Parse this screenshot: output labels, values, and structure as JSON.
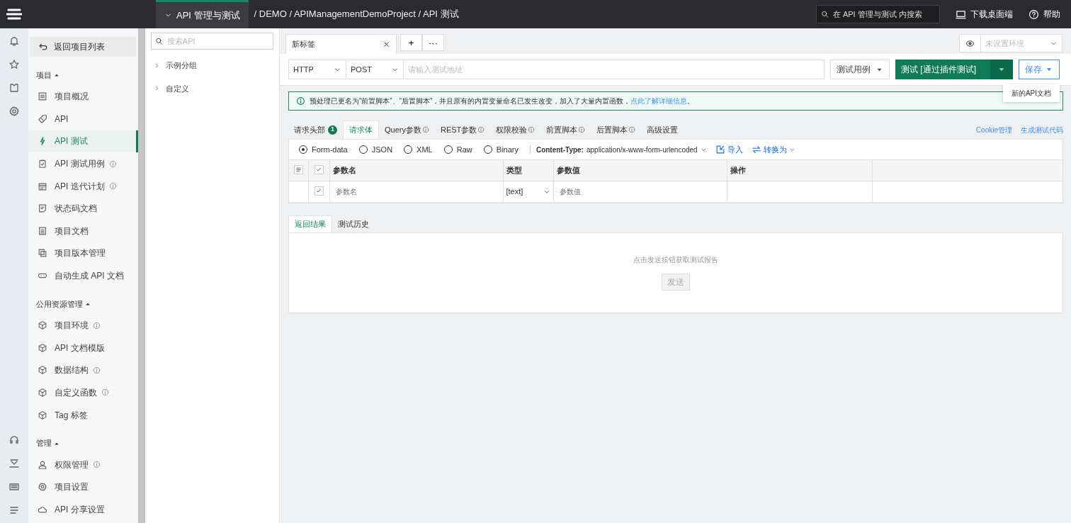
{
  "topbar": {
    "module": {
      "label": "API 管理与测试",
      "selected": true
    },
    "breadcrumb": "/ DEMO / APIManagementDemoProject / API 测试",
    "search_placeholder": "在 API 管理与测试 内搜索",
    "download": "下载桌面端",
    "help": "帮助"
  },
  "sidebar": {
    "back": "返回项目列表",
    "sections": [
      {
        "title": "项目",
        "expanded": true,
        "items": [
          {
            "label": "项目概况",
            "info": false,
            "selected": false
          },
          {
            "label": "API",
            "info": false,
            "selected": false
          },
          {
            "label": "API 测试",
            "info": false,
            "selected": true
          },
          {
            "label": "API 测试用例",
            "info": true,
            "selected": false
          },
          {
            "label": "API 迭代计划",
            "info": true,
            "selected": false
          },
          {
            "label": "状态码文档",
            "info": false,
            "selected": false
          },
          {
            "label": "项目文档",
            "info": false,
            "selected": false
          },
          {
            "label": "项目版本管理",
            "info": false,
            "selected": false
          },
          {
            "label": "自动生成 API 文档",
            "info": false,
            "selected": false
          }
        ]
      },
      {
        "title": "公用资源管理",
        "expanded": true,
        "items": [
          {
            "label": "项目环境",
            "info": true,
            "selected": false
          },
          {
            "label": "API 文档模版",
            "info": false,
            "selected": false
          },
          {
            "label": "数据结构",
            "info": true,
            "selected": false
          },
          {
            "label": "自定义函数",
            "info": true,
            "selected": false
          },
          {
            "label": "Tag 标签",
            "info": false,
            "selected": false
          }
        ]
      },
      {
        "title": "管理",
        "expanded": true,
        "items": [
          {
            "label": "权限管理",
            "info": true,
            "selected": false
          },
          {
            "label": "项目设置",
            "info": false,
            "selected": false
          },
          {
            "label": "API 分享设置",
            "info": false,
            "selected": false
          }
        ]
      }
    ]
  },
  "api_tree": {
    "search_placeholder": "搜索API",
    "groups": [
      {
        "label": "示例分组",
        "expanded": false
      },
      {
        "label": "自定义",
        "expanded": false
      }
    ]
  },
  "tabs": [
    {
      "label": "新标签",
      "selected": true
    }
  ],
  "tab_actions": [
    "+",
    "···"
  ],
  "environment": {
    "placeholder": "未设置环境"
  },
  "request": {
    "protocol": "HTTP",
    "method": "POST",
    "url_placeholder": "请输入测试地址",
    "test_case": "测试用例",
    "test_button": "测试 [通过插件测试]",
    "save_button": "保存",
    "save_menu": [
      "新的API文档"
    ]
  },
  "notice": {
    "text": "预处理已更名为“前置脚本”、“后置脚本”，并且原有的内置变量命名已发生改变，加入了大量内置函数，",
    "link": "点此了解详细信息",
    "tail": "。"
  },
  "request_tabs": [
    {
      "label": "请求头部",
      "badge": "1",
      "info": false,
      "selected": false
    },
    {
      "label": "请求体",
      "info": false,
      "selected": true
    },
    {
      "label": "Query参数",
      "info": true,
      "selected": false
    },
    {
      "label": "REST参数",
      "info": true,
      "selected": false
    },
    {
      "label": "权限校验",
      "info": true,
      "selected": false
    },
    {
      "label": "前置脚本",
      "info": true,
      "selected": false
    },
    {
      "label": "后置脚本",
      "info": true,
      "selected": false
    },
    {
      "label": "高级设置",
      "info": false,
      "selected": false
    }
  ],
  "request_links": [
    "Cookie管理",
    "生成测试代码"
  ],
  "body_types": [
    {
      "label": "Form-data",
      "selected": true
    },
    {
      "label": "JSON",
      "selected": false
    },
    {
      "label": "XML",
      "selected": false
    },
    {
      "label": "Raw",
      "selected": false
    },
    {
      "label": "Binary",
      "selected": false
    }
  ],
  "content_type": {
    "label": "Content-Type:",
    "value": "application/x-www-form-urlencoded"
  },
  "body_actions": [
    "导入",
    "转换为"
  ],
  "params_table": {
    "all_checked": true,
    "columns": [
      "参数名",
      "类型",
      "参数值",
      "操作"
    ],
    "rows": [
      {
        "checked": true,
        "name_placeholder": "参数名",
        "type": "[text]",
        "value_placeholder": "参数值"
      }
    ]
  },
  "result_tabs": [
    {
      "label": "返回结果",
      "selected": true
    },
    {
      "label": "测试历史",
      "selected": false
    }
  ],
  "result": {
    "message": "点击发送按钮获取测试报告",
    "send_button": "发送",
    "send_disabled": true
  }
}
